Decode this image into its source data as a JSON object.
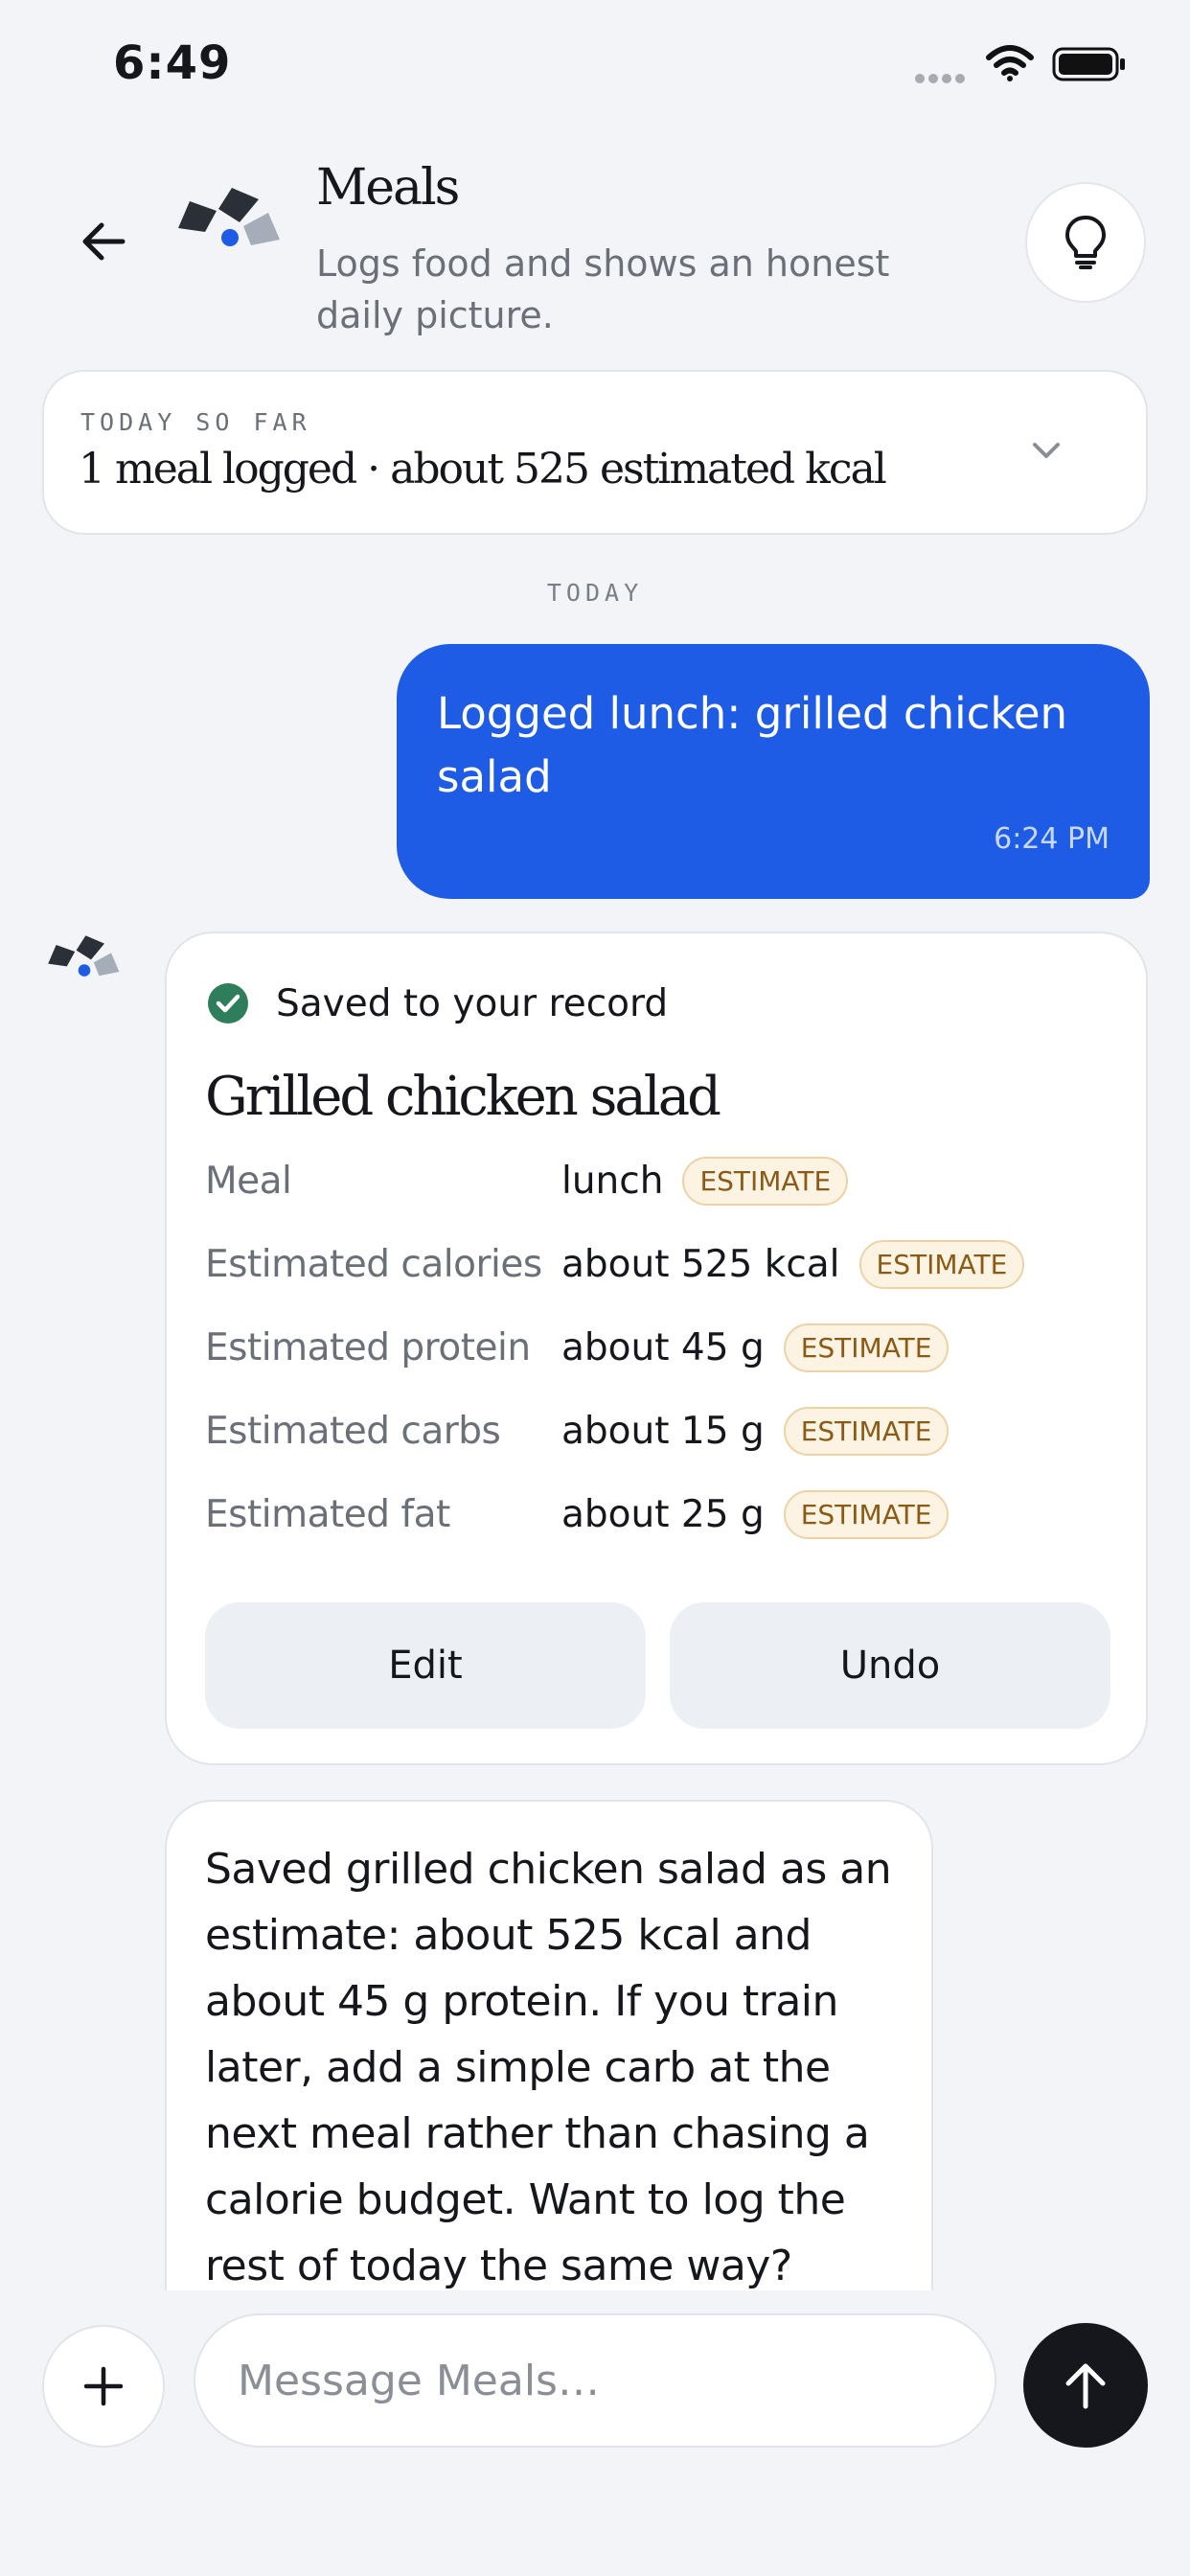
{
  "status_bar": {
    "time": "6:49",
    "signal_icon": "cellular-dots-icon",
    "wifi_icon": "wifi-icon",
    "battery_icon": "battery-full-icon"
  },
  "header": {
    "back_icon": "arrow-left-icon",
    "logo_icon": "meals-logo-icon",
    "title": "Meals",
    "subtitle": "Logs food and shows an honest daily picture.",
    "tip_icon": "lightbulb-icon"
  },
  "summary": {
    "eyebrow": "TODAY SO FAR",
    "text": "1 meal logged · about 525 estimated kcal",
    "chevron_icon": "chevron-down-icon"
  },
  "day_divider": "TODAY",
  "messages": {
    "user": {
      "text": "Logged lunch: grilled chicken salad",
      "time": "6:24 PM"
    },
    "record": {
      "status_icon": "check-circle-icon",
      "status_label": "Saved to your record",
      "title": "Grilled chicken salad",
      "fields": [
        {
          "label": "Meal",
          "value": "lunch",
          "badge": "ESTIMATE"
        },
        {
          "label": "Estimated calories",
          "value": "about 525 kcal",
          "badge": "ESTIMATE"
        },
        {
          "label": "Estimated protein",
          "value": "about 45 g",
          "badge": "ESTIMATE"
        },
        {
          "label": "Estimated carbs",
          "value": "about 15 g",
          "badge": "ESTIMATE"
        },
        {
          "label": "Estimated fat",
          "value": "about 25 g",
          "badge": "ESTIMATE"
        }
      ],
      "edit_label": "Edit",
      "undo_label": "Undo"
    },
    "reply": {
      "text": "Saved grilled chicken salad as an estimate: about 525 kcal and about 45 g protein. If you train later, add a simple carb at the next meal rather than chasing a calorie budget. Want to log the rest of today the same way?"
    }
  },
  "composer": {
    "plus_icon": "plus-icon",
    "placeholder": "Message Meals…",
    "value": "",
    "send_icon": "arrow-up-icon"
  },
  "colors": {
    "accent": "#1f5ce6",
    "background": "#f3f4f7",
    "success": "#2e7d5b",
    "badge_text": "#8a5a16",
    "badge_fill": "#fcf3e3"
  }
}
